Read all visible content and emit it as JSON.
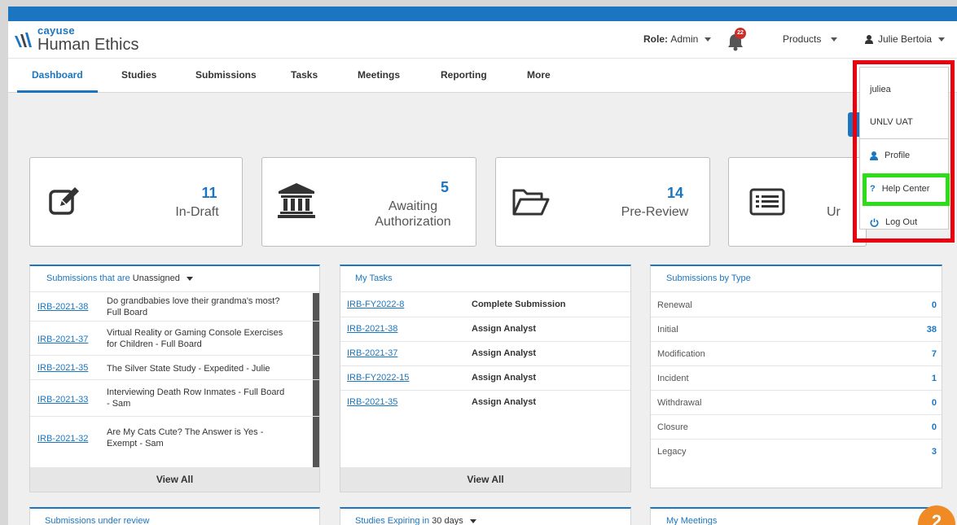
{
  "header": {
    "brand": "cayuse",
    "product": "Human Ethics",
    "role_label": "Role:",
    "role_value": "Admin",
    "notification_count": "22",
    "products_label": "Products",
    "user_name": "Julie Bertoia"
  },
  "nav": {
    "items": [
      "Dashboard",
      "Studies",
      "Submissions",
      "Tasks",
      "Meetings",
      "Reporting",
      "More"
    ]
  },
  "stats": [
    {
      "value": "11",
      "label": "In-Draft",
      "icon": "edit-icon"
    },
    {
      "value": "5",
      "label_line1": "Awaiting",
      "label_line2": "Authorization",
      "icon": "bank-icon"
    },
    {
      "value": "14",
      "label": "Pre-Review",
      "icon": "folder-icon"
    },
    {
      "label": "Ur",
      "icon": "list-icon"
    }
  ],
  "submissions_panel": {
    "title_prefix": "Submissions that are",
    "filter": "Unassigned",
    "rows": [
      {
        "id": "IRB-2021-38",
        "title_line1": "Do grandbabies love their grandma's most?",
        "title_line2": "Full Board"
      },
      {
        "id": "IRB-2021-37",
        "title_line1": "Virtual Reality or Gaming Console Exercises",
        "title_line2": "for Children - Full Board"
      },
      {
        "id": "IRB-2021-35",
        "title_line1": "The Silver State Study - Expedited - Julie",
        "title_line2": ""
      },
      {
        "id": "IRB-2021-33",
        "title_line1": "Interviewing Death Row Inmates - Full Board",
        "title_line2": "- Sam"
      },
      {
        "id": "IRB-2021-32",
        "title_line1": "Are My Cats Cute? The Answer is Yes -",
        "title_line2": "Exempt - Sam"
      }
    ],
    "view_all": "View All"
  },
  "tasks_panel": {
    "title": "My Tasks",
    "rows": [
      {
        "id": "IRB-FY2022-8",
        "task": "Complete Submission"
      },
      {
        "id": "IRB-2021-38",
        "task": "Assign Analyst"
      },
      {
        "id": "IRB-2021-37",
        "task": "Assign Analyst"
      },
      {
        "id": "IRB-FY2022-15",
        "task": "Assign Analyst"
      },
      {
        "id": "IRB-2021-35",
        "task": "Assign Analyst"
      }
    ],
    "view_all": "View All"
  },
  "types_panel": {
    "title": "Submissions by Type",
    "rows": [
      {
        "label": "Renewal",
        "value": "0"
      },
      {
        "label": "Initial",
        "value": "38"
      },
      {
        "label": "Modification",
        "value": "7"
      },
      {
        "label": "Incident",
        "value": "1"
      },
      {
        "label": "Withdrawal",
        "value": "0"
      },
      {
        "label": "Closure",
        "value": "0"
      },
      {
        "label": "Legacy",
        "value": "3"
      }
    ]
  },
  "bottom_panels": {
    "review_title": "Submissions under review",
    "expiring_prefix": "Studies Expiring in",
    "expiring_value": "30 days",
    "meetings_title": "My Meetings"
  },
  "user_menu": {
    "username": "juliea",
    "org": "UNLV UAT",
    "profile": "Profile",
    "help_mark": "?",
    "help": "Help Center",
    "logout": "Log Out"
  },
  "step_badge": "2",
  "colors": {
    "accent": "#1b75c0",
    "highlight_red": "#e8000e",
    "highlight_green": "#2edd1a",
    "badge_orange": "#f08a24"
  }
}
